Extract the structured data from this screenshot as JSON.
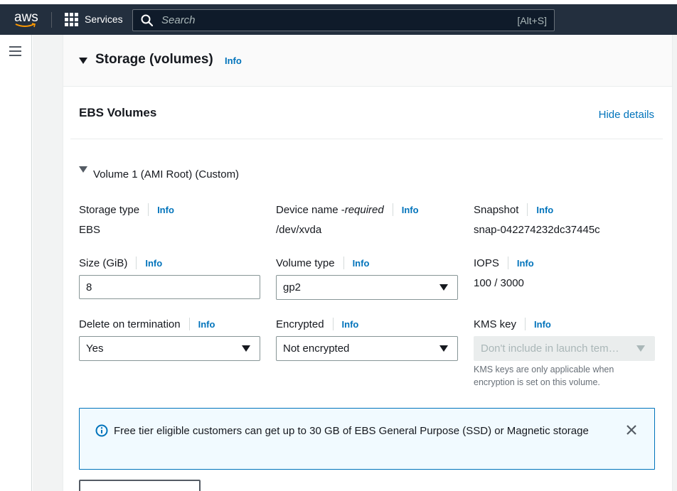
{
  "topbar": {
    "logo_text": "aws",
    "services_label": "Services",
    "search_placeholder": "Search",
    "search_shortcut": "[Alt+S]"
  },
  "section": {
    "title": "Storage (volumes)",
    "info": "Info",
    "subsection_title": "EBS Volumes",
    "hide_details": "Hide details",
    "volume_title": "Volume 1 (AMI Root) (Custom)"
  },
  "fields": {
    "storage_type": {
      "label": "Storage type",
      "info": "Info",
      "value": "EBS"
    },
    "device_name": {
      "label": "Device name - ",
      "label_em": "required",
      "info": "Info",
      "value": "/dev/xvda"
    },
    "snapshot": {
      "label": "Snapshot",
      "info": "Info",
      "value": "snap-042274232dc37445c"
    },
    "size": {
      "label": "Size (GiB)",
      "info": "Info",
      "value": "8"
    },
    "volume_type": {
      "label": "Volume type",
      "info": "Info",
      "value": "gp2"
    },
    "iops": {
      "label": "IOPS",
      "info": "Info",
      "value": "100 / 3000"
    },
    "delete_on_termination": {
      "label": "Delete on termination",
      "info": "Info",
      "value": "Yes"
    },
    "encrypted": {
      "label": "Encrypted",
      "info": "Info",
      "value": "Not encrypted"
    },
    "kms_key": {
      "label": "KMS key",
      "info": "Info",
      "value": "Don't include in launch tem…",
      "help": "KMS keys are only applicable when encryption is set on this volume."
    }
  },
  "alert": {
    "text": "Free tier eligible customers can get up to 30 GB of EBS General Purpose (SSD) or Magnetic storage"
  },
  "colors": {
    "topbar": "#232f3e",
    "link": "#0073bb",
    "alert_bg": "#f1faff",
    "alert_border": "#0073bb"
  }
}
